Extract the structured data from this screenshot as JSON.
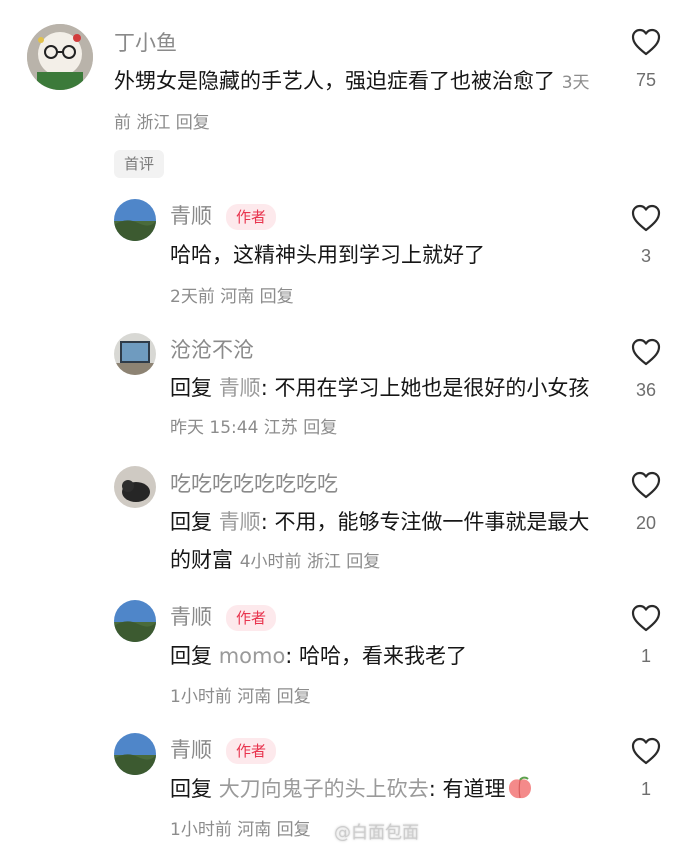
{
  "comments": [
    {
      "name": "丁小鱼",
      "text": "外甥女是隐藏的手艺人，强迫症看了也被治愈了",
      "meta": "3天前 浙江 回复",
      "likes": "75",
      "tag": "首评"
    }
  ],
  "replies": [
    {
      "name": "青顺",
      "badge": "作者",
      "text": "哈哈，这精神头用到学习上就好了",
      "meta": "2天前 河南 回复",
      "likes": "3"
    },
    {
      "name": "沧沧不沧",
      "reply_prefix": "回复 ",
      "reply_to": "青顺",
      "text": ": 不用在学习上她也是很好的小女孩",
      "meta": "昨天 15:44 江苏 回复",
      "likes": "36"
    },
    {
      "name": "吃吃吃吃吃吃吃吃",
      "reply_prefix": "回复 ",
      "reply_to": "青顺",
      "text": ": 不用，能够专注做一件事就是最大的财富",
      "meta": "4小时前 浙江 回复",
      "likes": "20"
    },
    {
      "name": "青顺",
      "badge": "作者",
      "reply_prefix": "回复 ",
      "reply_to": "momo",
      "text": ": 哈哈，看来我老了",
      "meta": "1小时前 河南 回复",
      "likes": "1"
    },
    {
      "name": "青顺",
      "badge": "作者",
      "reply_prefix": "回复 ",
      "reply_to": "大刀向鬼子的头上砍去",
      "text": ": 有道理",
      "meta": "1小时前 河南 回复",
      "likes": "1"
    }
  ],
  "watermark": "@白面包面"
}
